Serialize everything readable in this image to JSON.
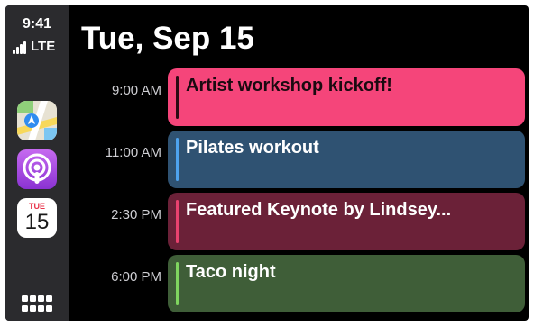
{
  "status_bar": {
    "time": "9:41",
    "network": "LTE"
  },
  "sidebar": {
    "apps": [
      {
        "name": "Maps",
        "icon": "maps-icon"
      },
      {
        "name": "Podcasts",
        "icon": "podcasts-icon"
      },
      {
        "name": "Calendar",
        "icon": "calendar-icon",
        "month": "TUE",
        "day": "15"
      }
    ],
    "app_grid_icon": "app-grid-icon"
  },
  "header": {
    "date_title": "Tue, Sep 15"
  },
  "events": [
    {
      "time": "9:00 AM",
      "title": "Artist workshop kickoff!",
      "card_color": "#f5457a",
      "accent_color": "#2b0b14",
      "text_color": "#1a0a10"
    },
    {
      "time": "11:00 AM",
      "title": "Pilates workout",
      "card_color": "#2f5272",
      "accent_color": "#4ea3ef",
      "text_color": "#ffffff"
    },
    {
      "time": "2:30 PM",
      "title": "Featured Keynote by Lindsey...",
      "card_color": "#6b2138",
      "accent_color": "#e9426f",
      "text_color": "#ffffff"
    },
    {
      "time": "6:00 PM",
      "title": "Taco night",
      "card_color": "#3f5e38",
      "accent_color": "#7fd55f",
      "text_color": "#ffffff"
    }
  ],
  "colors": {
    "background": "#000000",
    "sidebar": "#2b2b2e",
    "time_label": "#cfcfd4"
  }
}
